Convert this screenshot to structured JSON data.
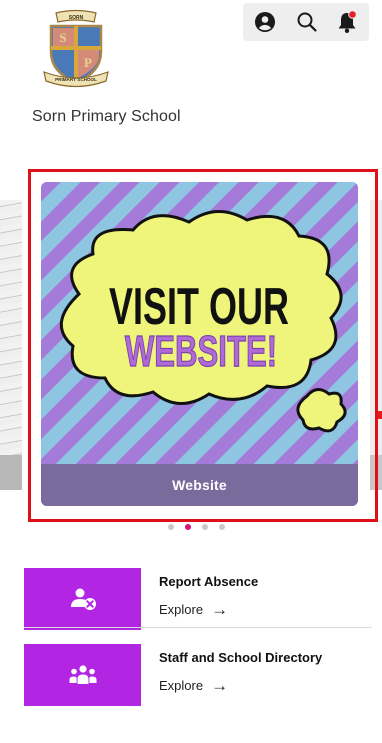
{
  "header": {
    "school_name": "Sorn Primary School",
    "crest": {
      "banner_top": "SORN",
      "banner_bottom": "PRIMARY SCHOOL",
      "letters": [
        "S",
        "P"
      ]
    }
  },
  "top_actions": {
    "profile_icon": "profile-icon",
    "search_icon": "search-icon",
    "bell_icon": "bell-icon",
    "has_notification_badge": true
  },
  "carousel": {
    "active_slide": {
      "art_line1": "VISIT OUR",
      "art_line2": "WEBSITE!",
      "caption": "Website"
    },
    "dot_count": 4,
    "active_dot": 2
  },
  "quick_links": [
    {
      "title": "Report Absence",
      "action": "Explore",
      "icon": "report-absence-icon"
    },
    {
      "title": "Staff and School Directory",
      "action": "Explore",
      "icon": "staff-directory-icon"
    }
  ],
  "colors": {
    "tile_purple": "#b125e3",
    "caption_bar": "#7b6a9c",
    "highlight_red": "#e01019",
    "dot_active": "#d8127a",
    "dot_inactive": "#c9c9c9"
  }
}
